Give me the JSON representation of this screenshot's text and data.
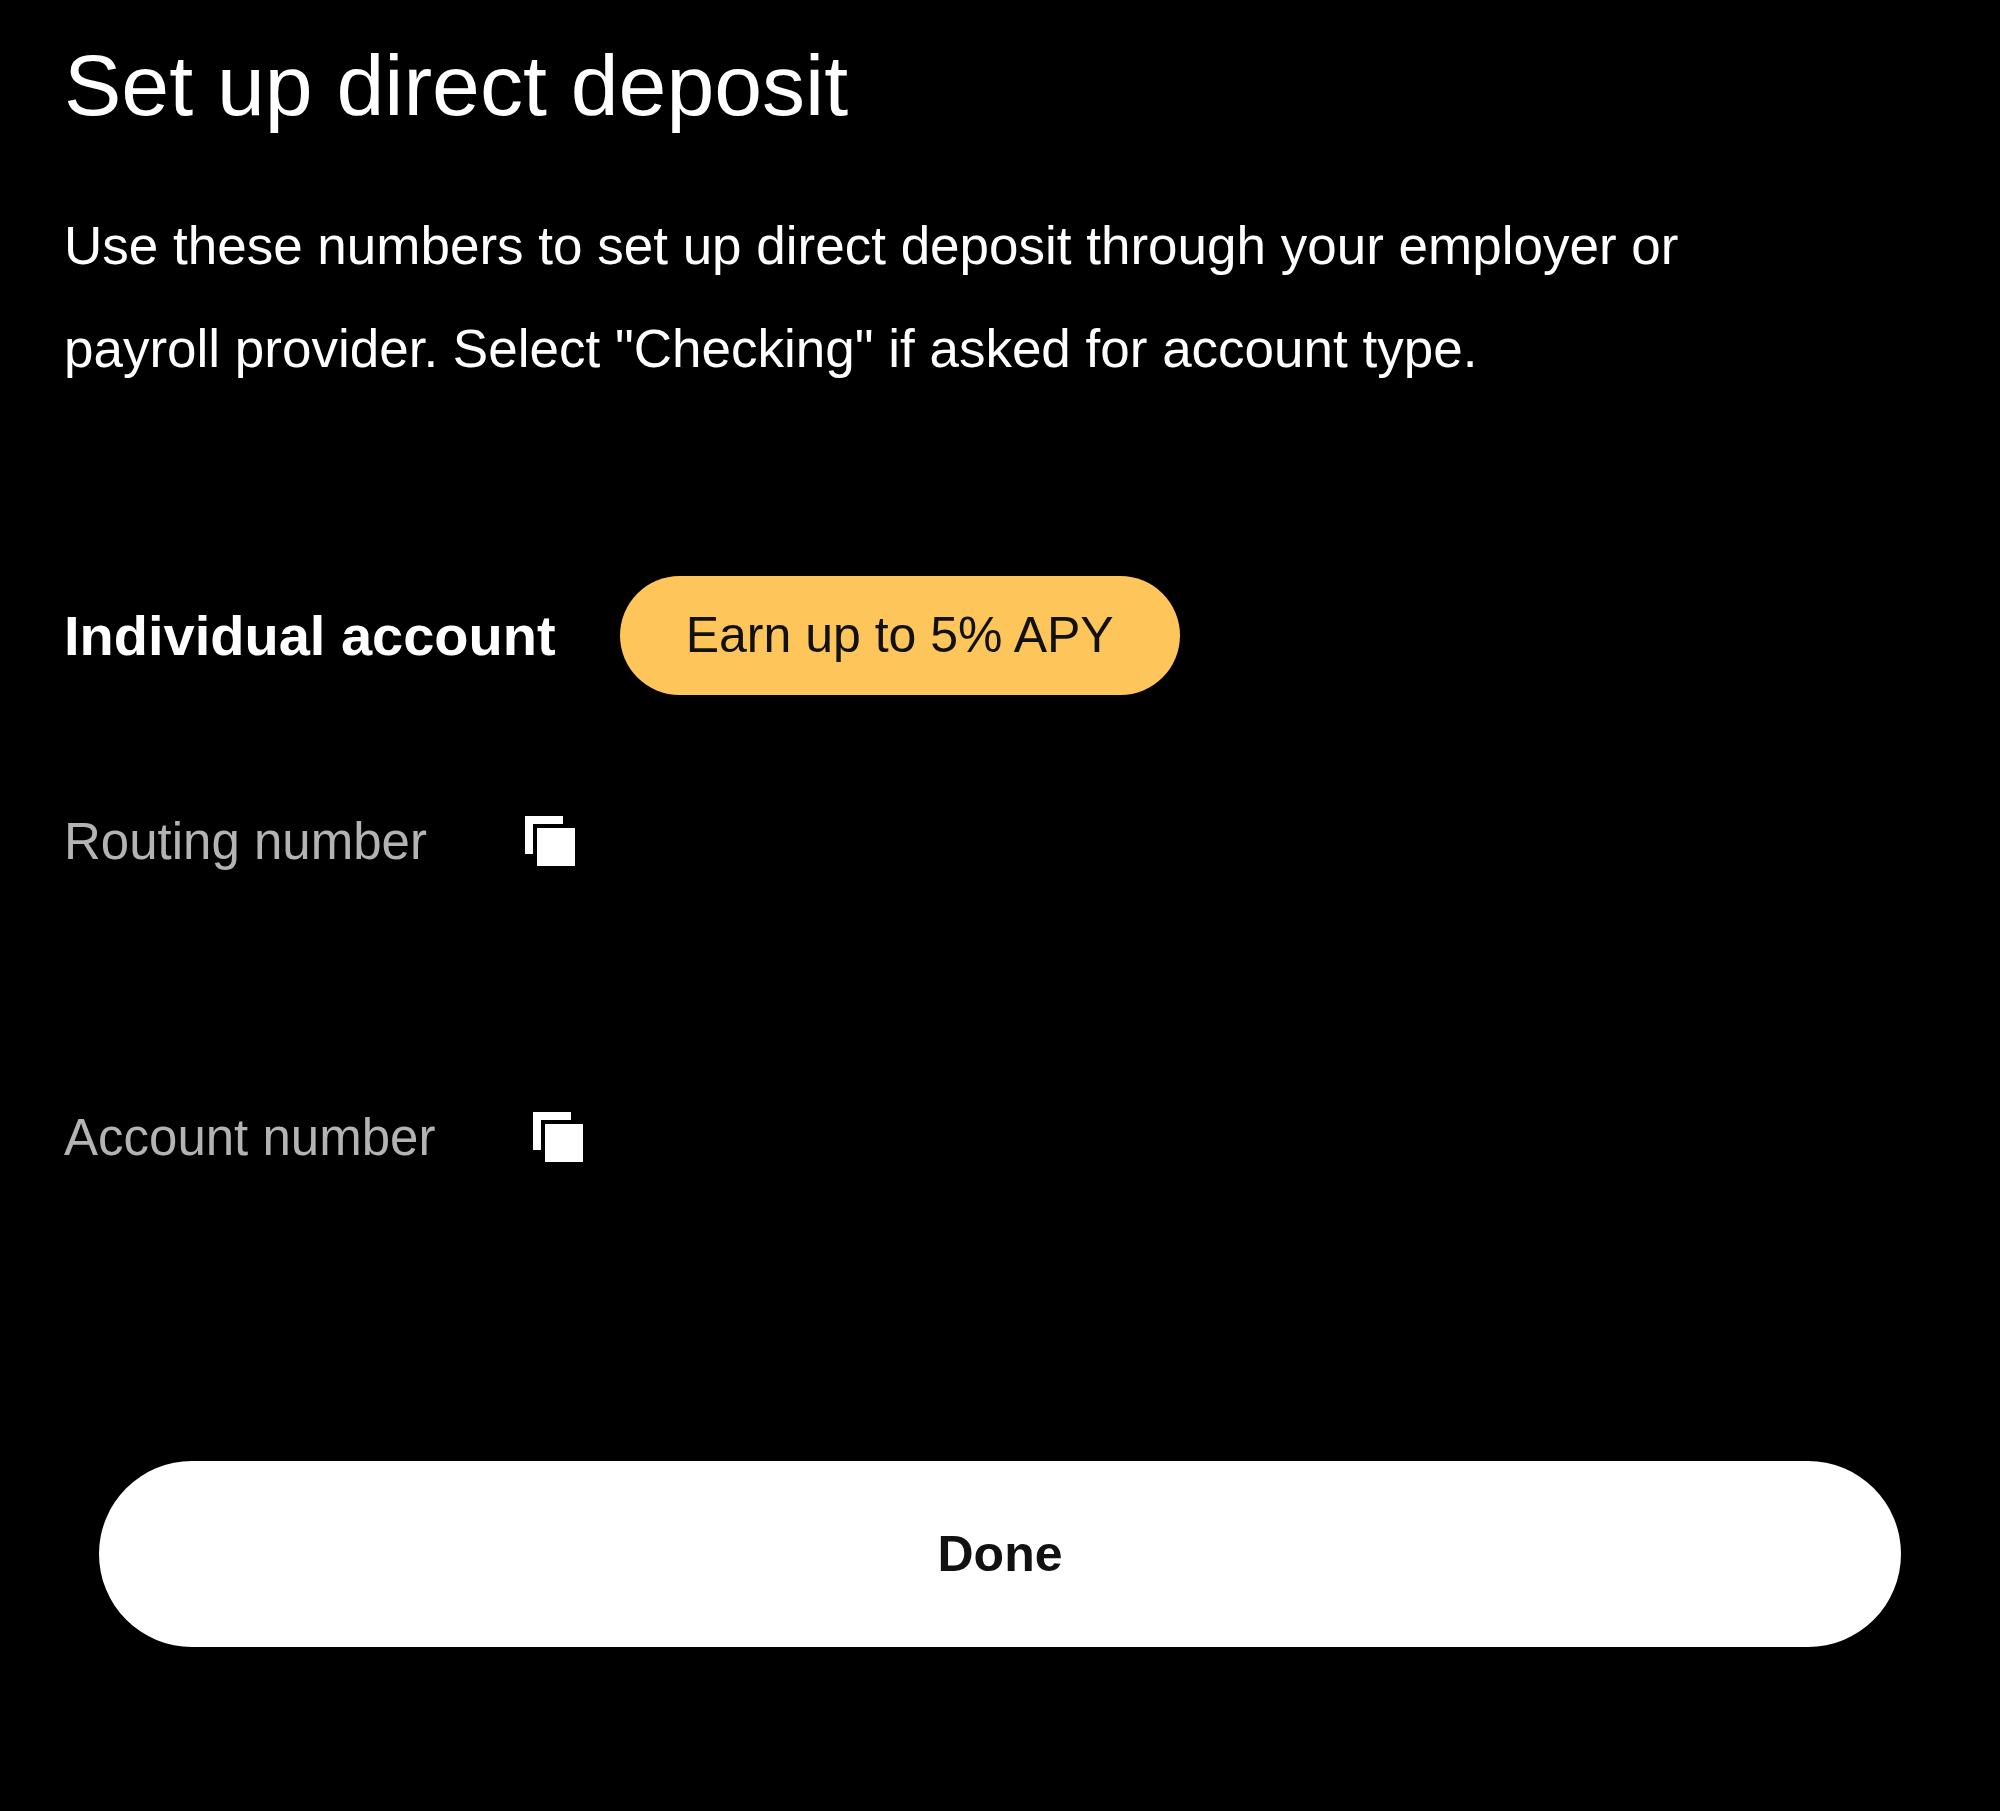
{
  "title": "Set up direct deposit",
  "description": "Use these numbers to set up direct deposit through your employer or payroll provider. Select \"Checking\" if asked for account type.",
  "account": {
    "heading": "Individual account",
    "badge": "Earn up to 5% APY"
  },
  "fields": [
    {
      "label": "Routing number"
    },
    {
      "label": "Account number"
    }
  ],
  "button": "Done"
}
